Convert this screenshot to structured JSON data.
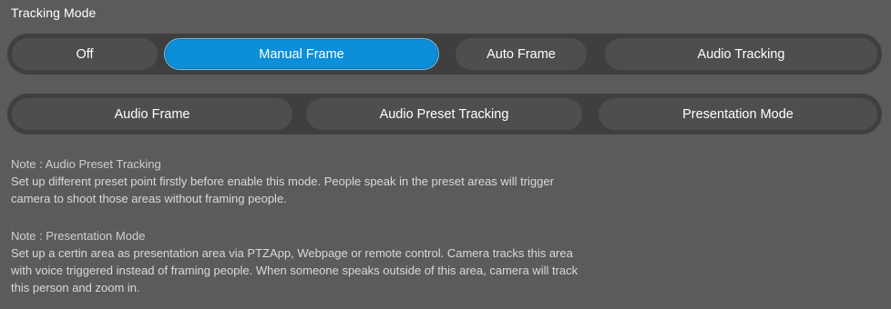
{
  "tracking_mode": {
    "title": "Tracking Mode",
    "row1": [
      "Off",
      "Manual Frame",
      "Auto Frame",
      "Audio Tracking"
    ],
    "row2": [
      "Audio Frame",
      "Audio Preset Tracking",
      "Presentation Mode"
    ],
    "selected": "Manual Frame"
  },
  "notes": [
    {
      "title": "Note : Audio Preset Tracking",
      "lines": [
        "Set up different preset point firstly before enable this mode. People speak in the preset areas will trigger",
        "camera to shoot those areas without framing people."
      ]
    },
    {
      "title": "Note : Presentation Mode",
      "lines": [
        "Set up a certin area as presentation area via PTZApp, Webpage or remote control. Camera tracks this area",
        "with voice triggered instead of framing people. When someone speaks outside of this area, camera will track",
        "this person and zoom in."
      ]
    }
  ],
  "colors": {
    "background": "#5b5b5b",
    "group_track": "#3f3f3f",
    "button": "#4e4e4e",
    "active_button": "#0a8fd8"
  }
}
